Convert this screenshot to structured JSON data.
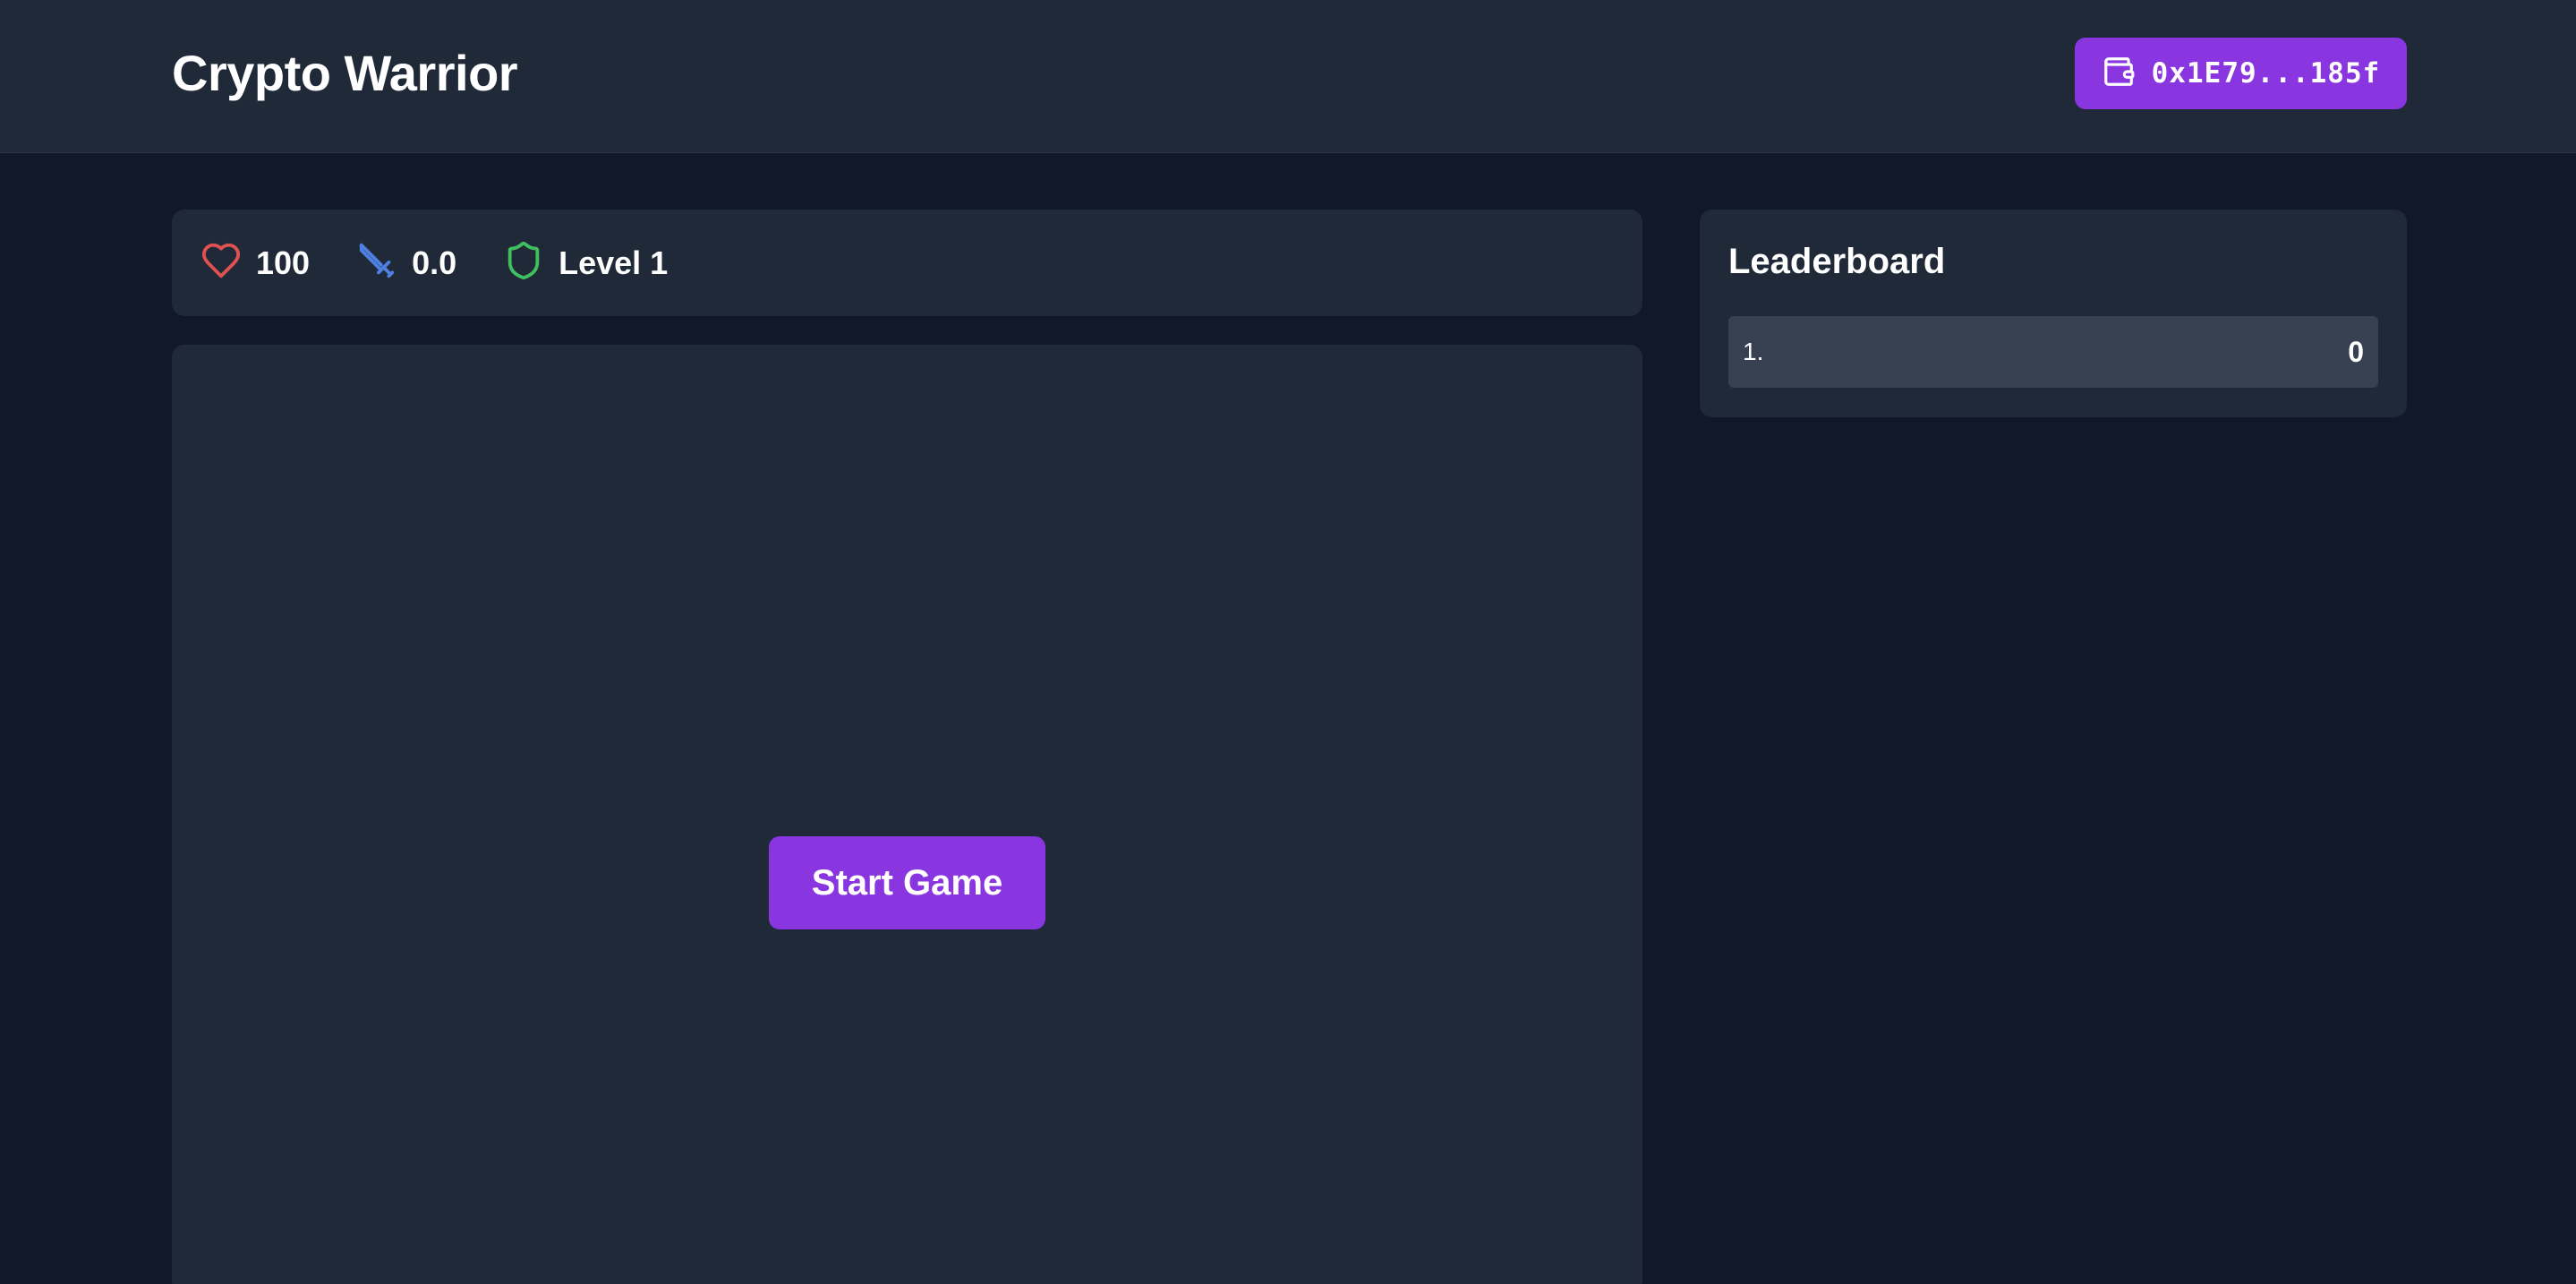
{
  "header": {
    "title": "Crypto Warrior",
    "wallet_address": "0x1E79...185f",
    "wallet_icon": "wallet-icon"
  },
  "stats": {
    "health": {
      "icon": "heart-icon",
      "value": "100",
      "color": "#e05252"
    },
    "attack": {
      "icon": "sword-icon",
      "value": "0.0",
      "color": "#4f7fe0"
    },
    "level": {
      "icon": "shield-icon",
      "value": "Level 1",
      "color": "#3fbf5f"
    }
  },
  "game": {
    "start_label": "Start Game"
  },
  "leaderboard": {
    "title": "Leaderboard",
    "entries": [
      {
        "rank": "1.",
        "name": "",
        "score": "0"
      }
    ]
  },
  "colors": {
    "background": "#111827",
    "panel": "#1f2937",
    "row": "#374151",
    "accent": "#8a36e0"
  }
}
